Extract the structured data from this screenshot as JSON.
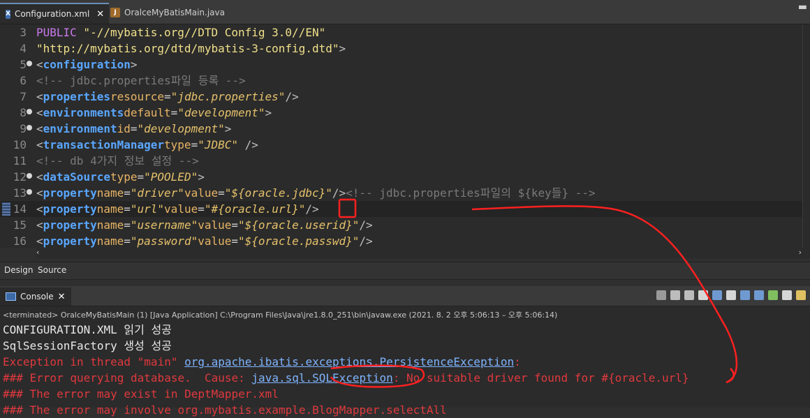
{
  "tabs": [
    {
      "label": "Configuration.xml",
      "icon": "xml-file-icon"
    },
    {
      "label": "OralceMyBatisMain.java",
      "icon": "java-file-icon"
    }
  ],
  "editor": {
    "lines": [
      {
        "n": "3",
        "fold": false,
        "parts": [
          [
            "txt",
            "  "
          ],
          [
            "kw",
            "PUBLIC"
          ],
          [
            "str",
            " \"-//mybatis.org//DTD Config 3.0//EN\""
          ]
        ]
      },
      {
        "n": "4",
        "fold": false,
        "parts": [
          [
            "txt",
            "  "
          ],
          [
            "str",
            "\"http://mybatis.org/dtd/mybatis-3-config.dtd\""
          ],
          [
            "br",
            ">"
          ]
        ]
      },
      {
        "n": "5",
        "fold": true,
        "parts": [
          [
            "br",
            "<"
          ],
          [
            "tag",
            "configuration"
          ],
          [
            "br",
            ">"
          ]
        ]
      },
      {
        "n": "6",
        "fold": false,
        "parts": [
          [
            "cmt",
            "<!-- jdbc.properties파일 등록 -->"
          ]
        ]
      },
      {
        "n": "7",
        "fold": false,
        "parts": [
          [
            "br",
            "<"
          ],
          [
            "tag",
            "properties"
          ],
          [
            "txt",
            " "
          ],
          [
            "attr",
            "resource"
          ],
          [
            "eq",
            "="
          ],
          [
            "val",
            "\"jdbc.properties\""
          ],
          [
            "br",
            "/>"
          ]
        ]
      },
      {
        "n": "8",
        "fold": true,
        "parts": [
          [
            "txt",
            "    "
          ],
          [
            "br",
            "<"
          ],
          [
            "tag",
            "environments"
          ],
          [
            "txt",
            " "
          ],
          [
            "attr",
            "default"
          ],
          [
            "eq",
            "="
          ],
          [
            "val",
            "\"development\""
          ],
          [
            "br",
            ">"
          ]
        ]
      },
      {
        "n": "9",
        "fold": true,
        "parts": [
          [
            "txt",
            "        "
          ],
          [
            "br",
            "<"
          ],
          [
            "tag",
            "environment"
          ],
          [
            "txt",
            " "
          ],
          [
            "attr",
            "id"
          ],
          [
            "eq",
            "="
          ],
          [
            "val",
            "\"development\""
          ],
          [
            "br",
            ">"
          ]
        ]
      },
      {
        "n": "10",
        "fold": false,
        "parts": [
          [
            "txt",
            "            "
          ],
          [
            "br",
            "<"
          ],
          [
            "tag",
            "transactionManager"
          ],
          [
            "txt",
            " "
          ],
          [
            "attr",
            "type"
          ],
          [
            "eq",
            "="
          ],
          [
            "val",
            "\"JDBC\""
          ],
          [
            "br",
            " />"
          ]
        ]
      },
      {
        "n": "11",
        "fold": false,
        "parts": [
          [
            "txt",
            "            "
          ],
          [
            "cmt",
            "<!-- db 4가지 정보 설정 -->"
          ]
        ]
      },
      {
        "n": "12",
        "fold": true,
        "parts": [
          [
            "txt",
            "            "
          ],
          [
            "br",
            "<"
          ],
          [
            "tag",
            "dataSource"
          ],
          [
            "txt",
            " "
          ],
          [
            "attr",
            "type"
          ],
          [
            "eq",
            "="
          ],
          [
            "val",
            "\"POOLED\""
          ],
          [
            "br",
            ">"
          ]
        ]
      },
      {
        "n": "13",
        "fold": true,
        "parts": [
          [
            "txt",
            "            "
          ],
          [
            "br",
            "<"
          ],
          [
            "tag",
            "property"
          ],
          [
            "txt",
            " "
          ],
          [
            "attr",
            "name"
          ],
          [
            "eq",
            "="
          ],
          [
            "val",
            "\"driver\""
          ],
          [
            "txt",
            " "
          ],
          [
            "attr",
            "value"
          ],
          [
            "eq",
            "="
          ],
          [
            "val",
            "\"${oracle.jdbc}\""
          ],
          [
            "br",
            "/>"
          ],
          [
            "cmt",
            "<!-- jdbc.properties파일의 ${key들} -->"
          ]
        ]
      },
      {
        "n": "14",
        "fold": false,
        "current": true,
        "parts": [
          [
            "txt",
            "            "
          ],
          [
            "br",
            "<"
          ],
          [
            "tag",
            "property"
          ],
          [
            "txt",
            " "
          ],
          [
            "attr",
            "name"
          ],
          [
            "eq",
            "="
          ],
          [
            "val",
            "\"url\""
          ],
          [
            "txt",
            "    "
          ],
          [
            "attr",
            "value"
          ],
          [
            "eq",
            "="
          ],
          [
            "val",
            "\"#{oracle.url}\""
          ],
          [
            "br",
            "/>"
          ]
        ]
      },
      {
        "n": "15",
        "fold": false,
        "parts": [
          [
            "txt",
            "            "
          ],
          [
            "br",
            "<"
          ],
          [
            "tag",
            "property"
          ],
          [
            "txt",
            " "
          ],
          [
            "attr",
            "name"
          ],
          [
            "eq",
            "="
          ],
          [
            "val",
            "\"username\""
          ],
          [
            "txt",
            " "
          ],
          [
            "attr",
            "value"
          ],
          [
            "eq",
            "="
          ],
          [
            "val",
            "\"${oracle.userid}\""
          ],
          [
            "br",
            "/>"
          ]
        ]
      },
      {
        "n": "16",
        "fold": false,
        "parts": [
          [
            "txt",
            "            "
          ],
          [
            "br",
            "<"
          ],
          [
            "tag",
            "property"
          ],
          [
            "txt",
            " "
          ],
          [
            "attr",
            "name"
          ],
          [
            "eq",
            "="
          ],
          [
            "val",
            "\"password\""
          ],
          [
            "txt",
            " "
          ],
          [
            "attr",
            "value"
          ],
          [
            "eq",
            "="
          ],
          [
            "val",
            "\"${oracle.passwd}\""
          ],
          [
            "br",
            "/>"
          ]
        ]
      }
    ]
  },
  "design_tabs": {
    "design": "Design",
    "source": "Source"
  },
  "console": {
    "title": "Console",
    "terminated": "<terminated> OralceMyBatisMain (1) [Java Application] C:\\Program Files\\Java\\jre1.8.0_251\\bin\\javaw.exe  (2021. 8. 2 오후 5:06:13 – 오후 5:06:14)",
    "lines": [
      {
        "parts": [
          [
            "white",
            "CONFIGURATION.XML 읽기 성공"
          ]
        ]
      },
      {
        "parts": [
          [
            "white",
            "SqlSessionFactory 생성 성공"
          ]
        ]
      },
      {
        "parts": [
          [
            "red",
            "Exception in thread \"main\" "
          ],
          [
            "link",
            "org.apache.ibatis.exceptions.PersistenceException"
          ],
          [
            "red",
            ":"
          ]
        ]
      },
      {
        "parts": [
          [
            "red",
            "### Error querying database.  Cause: "
          ],
          [
            "link",
            "java.sql."
          ],
          [
            "link",
            "SQLException"
          ],
          [
            "red",
            ": No suitable driver found for #{oracle.url}"
          ]
        ]
      },
      {
        "parts": [
          [
            "red",
            "### The error may exist in DeptMapper.xml"
          ]
        ]
      },
      {
        "parts": [
          [
            "red",
            "### The error may involve org.mybatis.example.BlogMapper.selectAll"
          ]
        ]
      }
    ]
  },
  "colors": {
    "accent": "#e0393e",
    "tag": "#5aa7ff",
    "link": "#7fb4ff"
  }
}
